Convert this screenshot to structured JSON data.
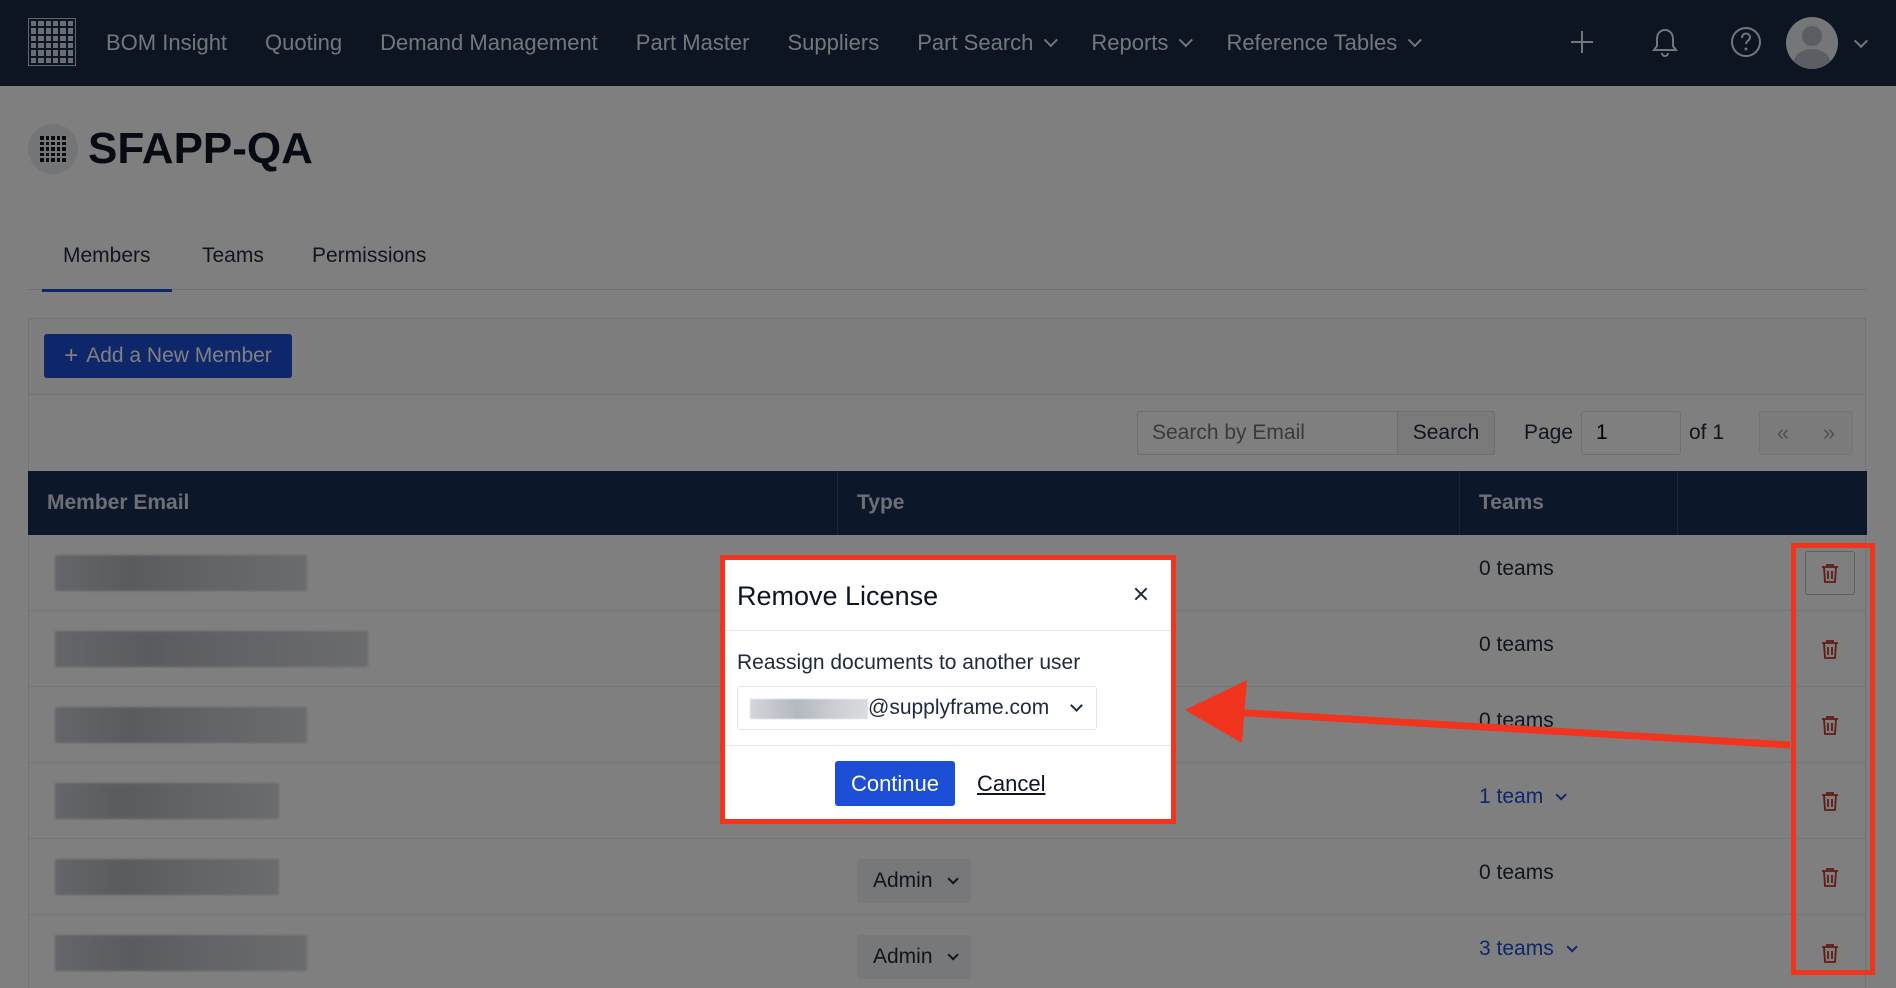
{
  "nav": {
    "items": [
      {
        "label": "BOM Insight",
        "dropdown": false
      },
      {
        "label": "Quoting",
        "dropdown": false
      },
      {
        "label": "Demand Management",
        "dropdown": false
      },
      {
        "label": "Part Master",
        "dropdown": false
      },
      {
        "label": "Suppliers",
        "dropdown": false
      },
      {
        "label": "Part Search",
        "dropdown": true
      },
      {
        "label": "Reports",
        "dropdown": true
      },
      {
        "label": "Reference Tables",
        "dropdown": true
      }
    ]
  },
  "page": {
    "title": "SFAPP-QA"
  },
  "tabs": [
    {
      "label": "Members",
      "active": true
    },
    {
      "label": "Teams",
      "active": false
    },
    {
      "label": "Permissions",
      "active": false
    }
  ],
  "toolbar": {
    "add_member_label": "Add a New Member",
    "search_placeholder": "Search by Email",
    "search_label": "Search",
    "page_label": "Page",
    "page_value": "1",
    "of_label": "of 1",
    "prev_label": "«",
    "next_label": "»"
  },
  "table": {
    "headers": [
      "Member Email",
      "Type",
      "Teams"
    ],
    "rows": [
      {
        "email_width": 0.74,
        "type": "",
        "teams": "0 teams",
        "teams_link": false
      },
      {
        "email_width": 0.92,
        "type": "",
        "teams": "0 teams",
        "teams_link": false
      },
      {
        "email_width": 0.74,
        "type": "",
        "teams": "0 teams",
        "teams_link": false
      },
      {
        "email_width": 0.66,
        "type": "",
        "teams": "1 team",
        "teams_link": true
      },
      {
        "email_width": 0.66,
        "type": "Admin",
        "teams": "0 teams",
        "teams_link": false
      },
      {
        "email_width": 0.74,
        "type": "Admin",
        "teams": "3 teams",
        "teams_link": true
      }
    ]
  },
  "modal": {
    "title": "Remove License",
    "label": "Reassign documents to another user",
    "select_domain": "@supplyframe.com",
    "continue_label": "Continue",
    "cancel_label": "Cancel"
  },
  "colors": {
    "nav_bg": "#1b2a47",
    "table_header_bg": "#1b2e55",
    "primary": "#1c4fd6",
    "trash": "#c0392b",
    "annotation": "#f0341d"
  }
}
